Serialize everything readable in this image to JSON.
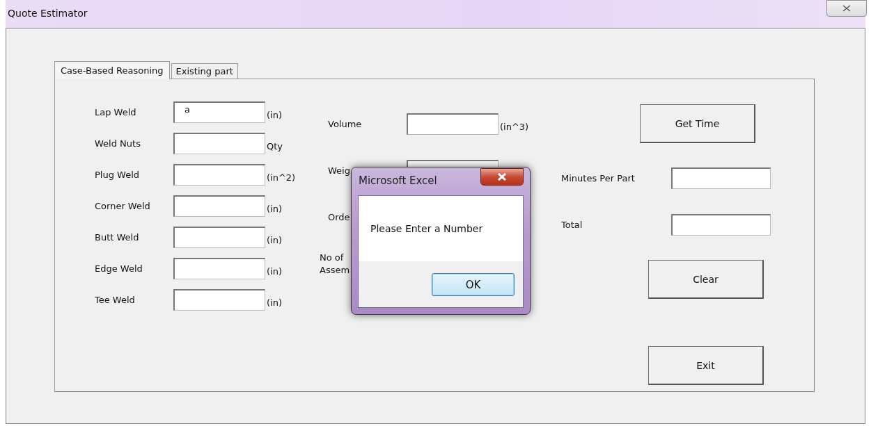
{
  "window": {
    "title": "Quote Estimator"
  },
  "tabs": [
    {
      "label": "Case-Based Reasoning",
      "selected": true
    },
    {
      "label": "Existing part",
      "selected": false
    }
  ],
  "weld_fields": [
    {
      "label": "Lap Weld",
      "value": "a",
      "unit": "(in)"
    },
    {
      "label": "Weld Nuts",
      "unit": "Qty"
    },
    {
      "label": "Plug Weld",
      "unit": "(in^2)"
    },
    {
      "label": "Corner Weld",
      "unit": "(in)"
    },
    {
      "label": "Butt Weld",
      "unit": "(in)"
    },
    {
      "label": "Edge Weld",
      "unit": "(in)"
    },
    {
      "label": "Tee Weld",
      "unit": "(in)"
    }
  ],
  "part_fields": [
    {
      "label_lines": [
        "Volume"
      ],
      "has_field": true,
      "unit": "(in^3)"
    },
    {
      "label_lines": [
        "Weig"
      ],
      "has_field": true
    },
    {
      "label_lines": [
        "Orde"
      ],
      "has_field": false
    },
    {
      "label_lines": [
        "No of",
        "Assem"
      ],
      "has_field": false
    }
  ],
  "get_time_button": "Get Time",
  "time_fields": [
    {
      "label": "Minutes Per Part"
    },
    {
      "label": "Total"
    }
  ],
  "clear_button": "Clear",
  "exit_button": "Exit",
  "dialog": {
    "title": "Microsoft Excel",
    "message": "Please Enter a Number",
    "button": "OK"
  }
}
